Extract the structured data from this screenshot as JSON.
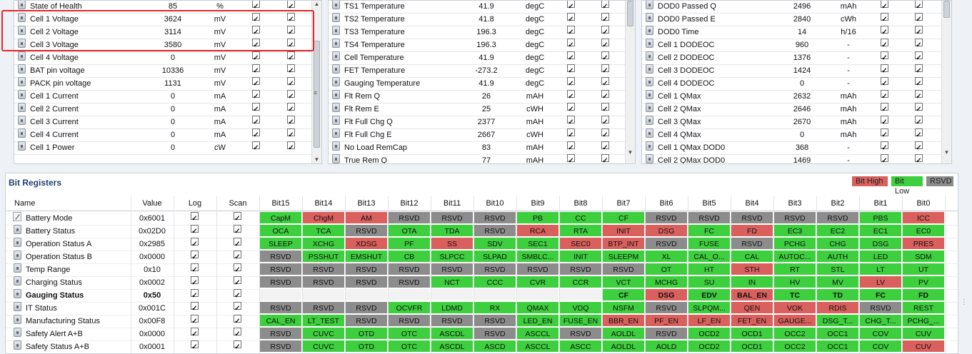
{
  "panel1": {
    "rows": [
      {
        "name": "State of Health",
        "value": "85",
        "unit": "%"
      },
      {
        "name": "Cell 1 Voltage",
        "value": "3624",
        "unit": "mV"
      },
      {
        "name": "Cell 2 Voltage",
        "value": "3114",
        "unit": "mV"
      },
      {
        "name": "Cell 3 Voltage",
        "value": "3580",
        "unit": "mV"
      },
      {
        "name": "Cell 4 Voltage",
        "value": "0",
        "unit": "mV"
      },
      {
        "name": "BAT pin voltage",
        "value": "10336",
        "unit": "mV"
      },
      {
        "name": "PACK pin voltage",
        "value": "1131",
        "unit": "mV"
      },
      {
        "name": "Cell 1 Current",
        "value": "0",
        "unit": "mA"
      },
      {
        "name": "Cell 2 Current",
        "value": "0",
        "unit": "mA"
      },
      {
        "name": "Cell 3 Current",
        "value": "0",
        "unit": "mA"
      },
      {
        "name": "Cell 4 Current",
        "value": "0",
        "unit": "mA"
      },
      {
        "name": "Cell 1 Power",
        "value": "0",
        "unit": "cW"
      }
    ]
  },
  "panel2": {
    "rows": [
      {
        "name": "TS1 Temperature",
        "value": "41.9",
        "unit": "degC"
      },
      {
        "name": "TS2 Temperature",
        "value": "41.8",
        "unit": "degC"
      },
      {
        "name": "TS3 Temperature",
        "value": "196.3",
        "unit": "degC"
      },
      {
        "name": "TS4 Temperature",
        "value": "196.3",
        "unit": "degC"
      },
      {
        "name": "Cell Temperature",
        "value": "41.9",
        "unit": "degC"
      },
      {
        "name": "FET Temperature",
        "value": "-273.2",
        "unit": "degC"
      },
      {
        "name": "Gauging Temperature",
        "value": "41.9",
        "unit": "degC"
      },
      {
        "name": "Flt Rem Q",
        "value": "26",
        "unit": "mAH"
      },
      {
        "name": "Flt Rem E",
        "value": "25",
        "unit": "cWH"
      },
      {
        "name": "Flt Full Chg Q",
        "value": "2377",
        "unit": "mAH"
      },
      {
        "name": "Flt Full Chg E",
        "value": "2667",
        "unit": "cWH"
      },
      {
        "name": "No Load RemCap",
        "value": "83",
        "unit": "mAH"
      },
      {
        "name": "True Rem Q",
        "value": "77",
        "unit": "mAH"
      }
    ]
  },
  "panel3": {
    "rows": [
      {
        "name": "DOD0 Passed Q",
        "value": "2496",
        "unit": "mAh"
      },
      {
        "name": "DOD0 Passed E",
        "value": "2840",
        "unit": "cWh"
      },
      {
        "name": "DOD0 Time",
        "value": "14",
        "unit": "h/16"
      },
      {
        "name": "Cell 1 DODEOC",
        "value": "960",
        "unit": "-"
      },
      {
        "name": "Cell 2 DODEOC",
        "value": "1376",
        "unit": "-"
      },
      {
        "name": "Cell 3 DODEOC",
        "value": "1424",
        "unit": "-"
      },
      {
        "name": "Cell 4 DODEOC",
        "value": "0",
        "unit": "-"
      },
      {
        "name": "Cell 1 QMax",
        "value": "2632",
        "unit": "mAh"
      },
      {
        "name": "Cell 2 QMax",
        "value": "2646",
        "unit": "mAh"
      },
      {
        "name": "Cell 3 QMax",
        "value": "2670",
        "unit": "mAh"
      },
      {
        "name": "Cell 4 QMax",
        "value": "0",
        "unit": "mAh"
      },
      {
        "name": "Cell 1 QMax DOD0",
        "value": "368",
        "unit": "-"
      },
      {
        "name": "Cell 2 QMax DOD0",
        "value": "1469",
        "unit": "-"
      }
    ]
  },
  "bits": {
    "title": "Bit Registers",
    "legend": [
      {
        "label": "Bit High",
        "color": "#d9605d"
      },
      {
        "label": "Bit Low",
        "color": "#3ecf3e"
      },
      {
        "label": "RSVD",
        "color": "#8c8c8c"
      }
    ],
    "headers": {
      "name": "Name",
      "value": "Value",
      "log": "Log",
      "scan": "Scan",
      "bits": [
        "Bit15",
        "Bit14",
        "Bit13",
        "Bit12",
        "Bit11",
        "Bit10",
        "Bit9",
        "Bit8",
        "Bit7",
        "Bit6",
        "Bit5",
        "Bit4",
        "Bit3",
        "Bit2",
        "Bit1",
        "Bit0"
      ]
    },
    "colors": {
      "high": "#d9605d",
      "low": "#3ecf3e",
      "rsvd": "#8c8c8c",
      "none": "#f2f2f2"
    },
    "rows": [
      {
        "name": "Battery Mode",
        "value": "0x6001",
        "icon": "pencil",
        "cells": [
          [
            "CapM",
            "L"
          ],
          [
            "ChgM",
            "H"
          ],
          [
            "AM",
            "H"
          ],
          [
            "RSVD",
            "R"
          ],
          [
            "RSVD",
            "R"
          ],
          [
            "RSVD",
            "R"
          ],
          [
            "PB",
            "L"
          ],
          [
            "CC",
            "L"
          ],
          [
            "CF",
            "L"
          ],
          [
            "RSVD",
            "R"
          ],
          [
            "RSVD",
            "R"
          ],
          [
            "RSVD",
            "R"
          ],
          [
            "RSVD",
            "R"
          ],
          [
            "RSVD",
            "R"
          ],
          [
            "PBS",
            "L"
          ],
          [
            "ICC",
            "H"
          ]
        ]
      },
      {
        "name": "Battery Status",
        "value": "0x02D0",
        "icon": "lock",
        "cells": [
          [
            "OCA",
            "L"
          ],
          [
            "TCA",
            "L"
          ],
          [
            "RSVD",
            "R"
          ],
          [
            "OTA",
            "L"
          ],
          [
            "TDA",
            "L"
          ],
          [
            "RSVD",
            "R"
          ],
          [
            "RCA",
            "H"
          ],
          [
            "RTA",
            "L"
          ],
          [
            "INIT",
            "H"
          ],
          [
            "DSG",
            "H"
          ],
          [
            "FC",
            "L"
          ],
          [
            "FD",
            "H"
          ],
          [
            "EC3",
            "L"
          ],
          [
            "EC2",
            "L"
          ],
          [
            "EC1",
            "L"
          ],
          [
            "EC0",
            "L"
          ]
        ]
      },
      {
        "name": "Operation Status A",
        "value": "0x2985",
        "icon": "lock",
        "cells": [
          [
            "SLEEP",
            "L"
          ],
          [
            "XCHG",
            "L"
          ],
          [
            "XDSG",
            "H"
          ],
          [
            "PF",
            "L"
          ],
          [
            "SS",
            "H"
          ],
          [
            "SDV",
            "L"
          ],
          [
            "SEC1",
            "L"
          ],
          [
            "SEC0",
            "H"
          ],
          [
            "BTP_INT",
            "H"
          ],
          [
            "RSVD",
            "R"
          ],
          [
            "FUSE",
            "L"
          ],
          [
            "RSVD",
            "R"
          ],
          [
            "PCHG",
            "L"
          ],
          [
            "CHG",
            "L"
          ],
          [
            "DSG",
            "L"
          ],
          [
            "PRES",
            "H"
          ]
        ]
      },
      {
        "name": "Operation Status B",
        "value": "0x0000",
        "icon": "lock",
        "cells": [
          [
            "RSVD",
            "R"
          ],
          [
            "PSSHUT",
            "L"
          ],
          [
            "EMSHUT",
            "L"
          ],
          [
            "CB",
            "L"
          ],
          [
            "SLPCC",
            "L"
          ],
          [
            "SLPAD",
            "L"
          ],
          [
            "SMBLC...",
            "L"
          ],
          [
            "INIT",
            "L"
          ],
          [
            "SLEEPM",
            "L"
          ],
          [
            "XL",
            "L"
          ],
          [
            "CAL_O...",
            "L"
          ],
          [
            "CAL",
            "L"
          ],
          [
            "AUTOC...",
            "L"
          ],
          [
            "AUTH",
            "L"
          ],
          [
            "LED",
            "L"
          ],
          [
            "SDM",
            "L"
          ]
        ]
      },
      {
        "name": "Temp Range",
        "value": "0x10",
        "icon": "lock",
        "cells": [
          [
            "RSVD",
            "R"
          ],
          [
            "RSVD",
            "R"
          ],
          [
            "RSVD",
            "R"
          ],
          [
            "RSVD",
            "R"
          ],
          [
            "RSVD",
            "R"
          ],
          [
            "RSVD",
            "R"
          ],
          [
            "RSVD",
            "R"
          ],
          [
            "RSVD",
            "R"
          ],
          [
            "RSVD",
            "R"
          ],
          [
            "OT",
            "L"
          ],
          [
            "HT",
            "L"
          ],
          [
            "STH",
            "H"
          ],
          [
            "RT",
            "L"
          ],
          [
            "STL",
            "L"
          ],
          [
            "LT",
            "L"
          ],
          [
            "UT",
            "L"
          ]
        ]
      },
      {
        "name": "Charging Status",
        "value": "0x0002",
        "icon": "lock",
        "cells": [
          [
            "RSVD",
            "R"
          ],
          [
            "RSVD",
            "R"
          ],
          [
            "RSVD",
            "R"
          ],
          [
            "RSVD",
            "R"
          ],
          [
            "NCT",
            "L"
          ],
          [
            "CCC",
            "L"
          ],
          [
            "CVR",
            "L"
          ],
          [
            "CCR",
            "L"
          ],
          [
            "VCT",
            "L"
          ],
          [
            "MCHG",
            "L"
          ],
          [
            "SU",
            "L"
          ],
          [
            "IN",
            "L"
          ],
          [
            "HV",
            "L"
          ],
          [
            "MV",
            "L"
          ],
          [
            "LV",
            "H"
          ],
          [
            "PV",
            "L"
          ]
        ]
      },
      {
        "name": "Gauging Status",
        "value": "0x50",
        "icon": "lock",
        "bold": true,
        "cells": [
          [
            "",
            ""
          ],
          [
            "",
            ""
          ],
          [
            "",
            ""
          ],
          [
            "",
            ""
          ],
          [
            "",
            ""
          ],
          [
            "",
            ""
          ],
          [
            "",
            ""
          ],
          [
            "",
            ""
          ],
          [
            "CF",
            "L"
          ],
          [
            "DSG",
            "H"
          ],
          [
            "EDV",
            "L"
          ],
          [
            "BAL_EN",
            "H"
          ],
          [
            "TC",
            "L"
          ],
          [
            "TD",
            "L"
          ],
          [
            "FC",
            "L"
          ],
          [
            "FD",
            "L"
          ]
        ]
      },
      {
        "name": "IT Status",
        "value": "0x001C",
        "icon": "lock",
        "cells": [
          [
            "RSVD",
            "R"
          ],
          [
            "RSVD",
            "R"
          ],
          [
            "RSVD",
            "R"
          ],
          [
            "OCVFR",
            "L"
          ],
          [
            "LDMD",
            "L"
          ],
          [
            "RX",
            "L"
          ],
          [
            "QMAX",
            "L"
          ],
          [
            "VDQ",
            "L"
          ],
          [
            "NSFM",
            "L"
          ],
          [
            "RSVD",
            "R"
          ],
          [
            "SLPQM...",
            "L"
          ],
          [
            "QEN",
            "H"
          ],
          [
            "VOK",
            "H"
          ],
          [
            "RDIS",
            "H"
          ],
          [
            "RSVD",
            "R"
          ],
          [
            "REST",
            "L"
          ]
        ]
      },
      {
        "name": "Manufacturing Status",
        "value": "0x00F8",
        "icon": "lock",
        "cells": [
          [
            "CAL_EN",
            "L"
          ],
          [
            "LT_TEST",
            "L"
          ],
          [
            "RSVD",
            "R"
          ],
          [
            "RSVD",
            "R"
          ],
          [
            "RSVD",
            "R"
          ],
          [
            "RSVD",
            "R"
          ],
          [
            "LED_EN",
            "L"
          ],
          [
            "FUSE_EN",
            "L"
          ],
          [
            "BBR_EN",
            "H"
          ],
          [
            "PF_EN",
            "H"
          ],
          [
            "LF_EN",
            "H"
          ],
          [
            "FET_EN",
            "H"
          ],
          [
            "GAUGE...",
            "H"
          ],
          [
            "DSG_T...",
            "L"
          ],
          [
            "CHG_T...",
            "L"
          ],
          [
            "PCHG_...",
            "L"
          ]
        ]
      },
      {
        "name": "Safety Alert A+B",
        "value": "0x0000",
        "icon": "lock",
        "cells": [
          [
            "RSVD",
            "R"
          ],
          [
            "CUVC",
            "L"
          ],
          [
            "OTD",
            "L"
          ],
          [
            "OTC",
            "L"
          ],
          [
            "ASCDL",
            "L"
          ],
          [
            "RSVD",
            "R"
          ],
          [
            "ASCCL",
            "L"
          ],
          [
            "RSVD",
            "R"
          ],
          [
            "AOLDL",
            "L"
          ],
          [
            "RSVD",
            "R"
          ],
          [
            "OCD2",
            "L"
          ],
          [
            "OCD1",
            "L"
          ],
          [
            "OCC2",
            "L"
          ],
          [
            "OCC1",
            "L"
          ],
          [
            "COV",
            "L"
          ],
          [
            "CUV",
            "L"
          ]
        ]
      },
      {
        "name": "Safety Status A+B",
        "value": "0x0001",
        "icon": "lock",
        "cells": [
          [
            "RSVD",
            "R"
          ],
          [
            "CUVC",
            "L"
          ],
          [
            "OTD",
            "L"
          ],
          [
            "OTC",
            "L"
          ],
          [
            "ASCDL",
            "L"
          ],
          [
            "ASCD",
            "L"
          ],
          [
            "ASCCL",
            "L"
          ],
          [
            "ASCC",
            "L"
          ],
          [
            "AOLDL",
            "L"
          ],
          [
            "AOLD",
            "L"
          ],
          [
            "OCD2",
            "L"
          ],
          [
            "OCD1",
            "L"
          ],
          [
            "OCC2",
            "L"
          ],
          [
            "OCC1",
            "L"
          ],
          [
            "COV",
            "L"
          ],
          [
            "CUV",
            "H"
          ]
        ]
      }
    ]
  }
}
